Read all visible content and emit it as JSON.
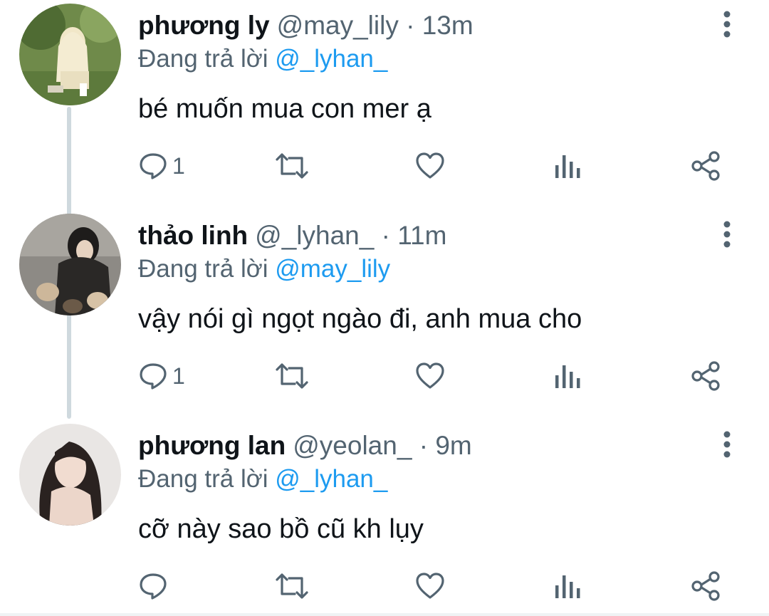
{
  "tweets": [
    {
      "name": "phương ly",
      "handle": "@may_lily",
      "time": "13m",
      "reply_prefix": "Đang trả lời",
      "reply_to": "@_lyhan_",
      "text": "bé muốn mua con mer ạ",
      "reply_count": "1",
      "avatar_icon": "avatar-photo"
    },
    {
      "name": "thảo linh",
      "handle": "@_lyhan_",
      "time": "11m",
      "reply_prefix": "Đang trả lời",
      "reply_to": "@may_lily",
      "text": "vậy nói gì ngọt ngào đi, anh mua cho",
      "reply_count": "1",
      "avatar_icon": "avatar-photo"
    },
    {
      "name": "phương lan",
      "handle": "@yeolan_",
      "time": "9m",
      "reply_prefix": "Đang trả lời",
      "reply_to": "@_lyhan_",
      "text": "cỡ này sao bồ cũ kh lụy",
      "reply_count": "",
      "avatar_icon": "avatar-photo"
    }
  ],
  "separator": "·",
  "colors": {
    "text_primary": "#0f1419",
    "text_secondary": "#536471",
    "link": "#1d9bf0",
    "thread_line": "#cfd9de"
  },
  "icons": {
    "reply": "reply-icon",
    "retweet": "retweet-icon",
    "like": "heart-icon",
    "views": "views-icon",
    "share": "share-icon",
    "more": "more-options-icon"
  }
}
